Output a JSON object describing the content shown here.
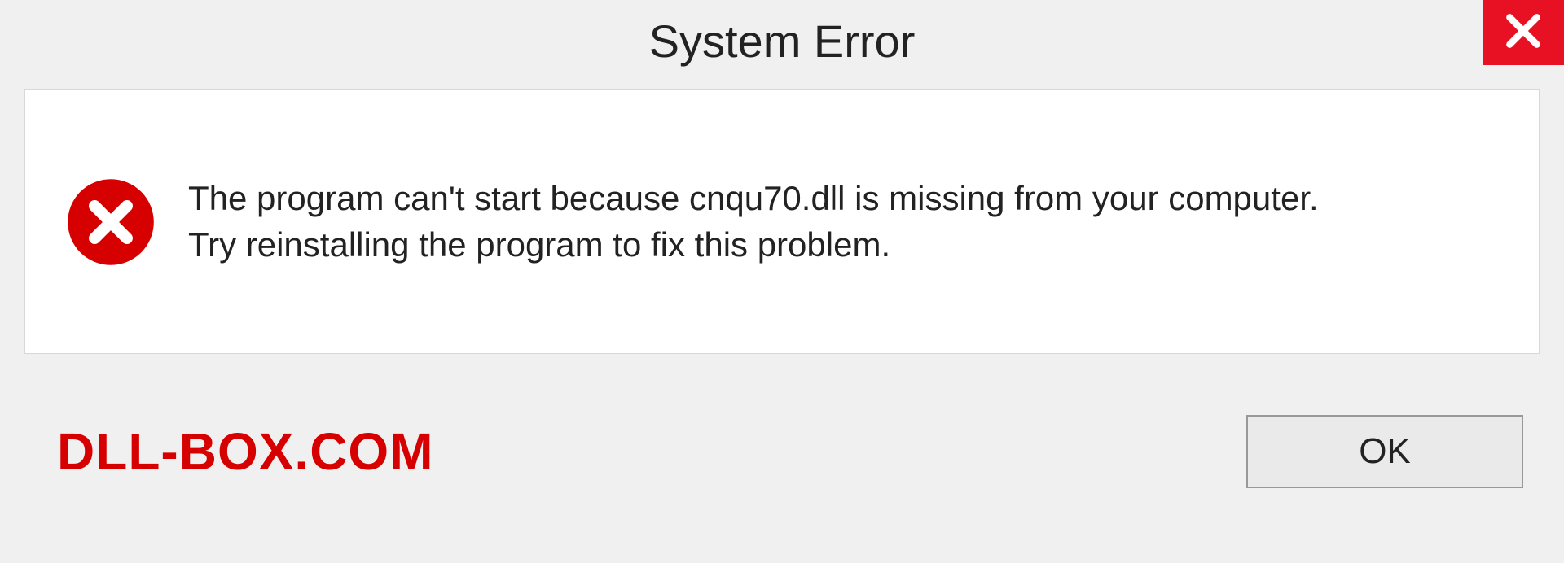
{
  "window": {
    "title": "System Error"
  },
  "message": {
    "line1": "The program can't start because cnqu70.dll is missing from your computer.",
    "line2": "Try reinstalling the program to fix this problem."
  },
  "footer": {
    "watermark": "DLL-BOX.COM",
    "ok_label": "OK"
  },
  "colors": {
    "close_bg": "#e81123",
    "error_red": "#d60000"
  }
}
